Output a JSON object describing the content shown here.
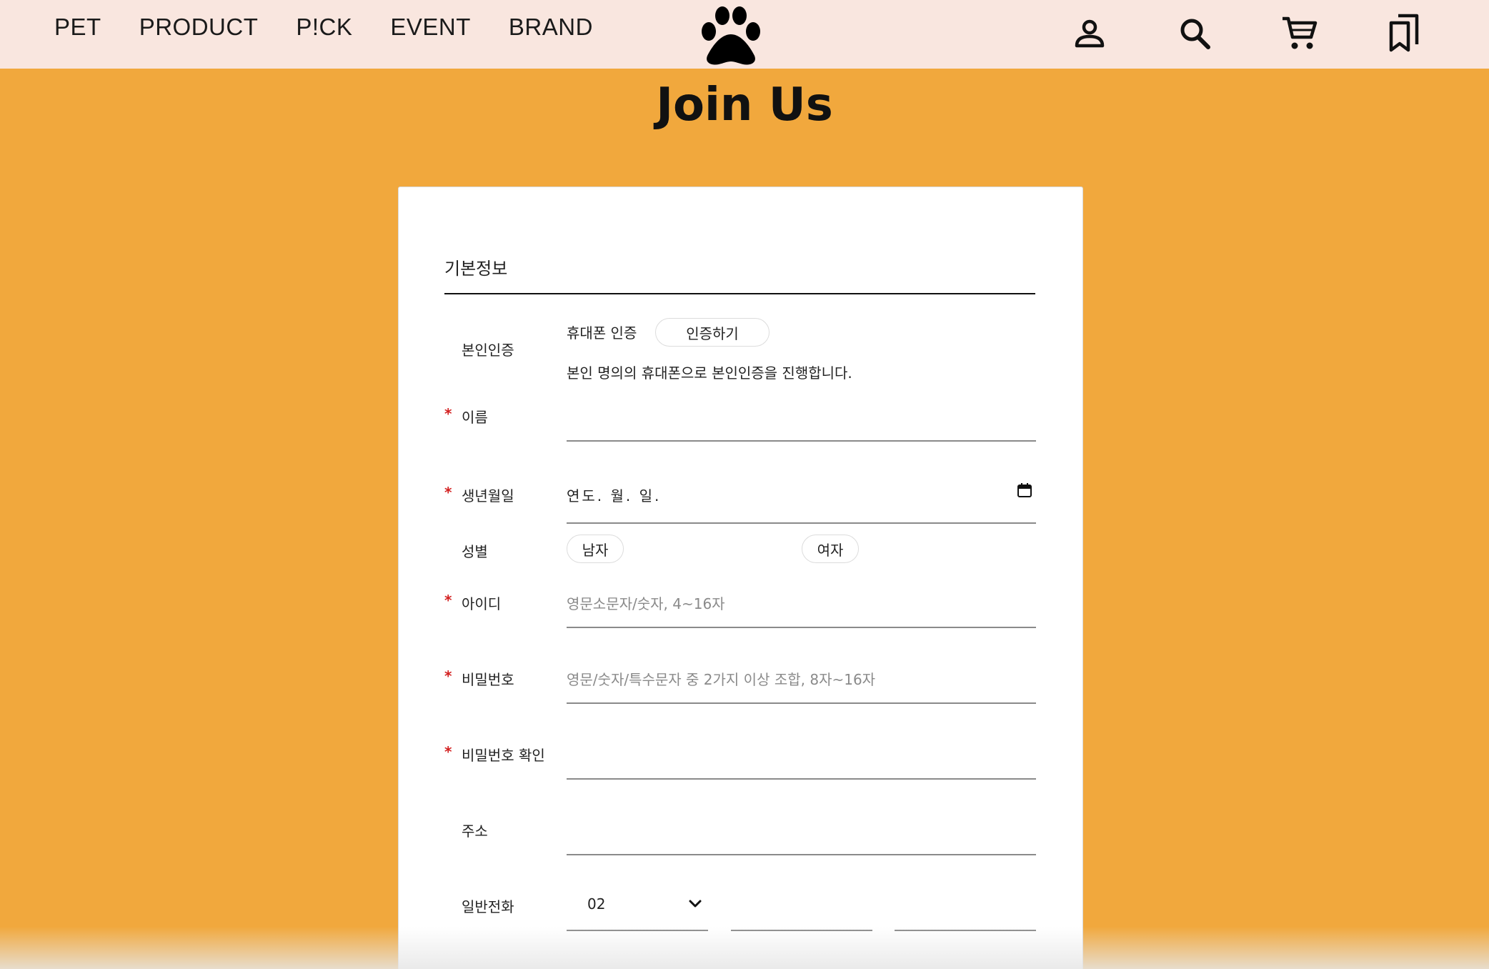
{
  "nav": {
    "items": [
      "PET",
      "PRODUCT",
      "P!CK",
      "EVENT",
      "BRAND"
    ]
  },
  "header_icons": [
    "user-icon",
    "search-icon",
    "cart-icon",
    "bookmark-icon"
  ],
  "page_title": "Join Us",
  "colors": {
    "background": "#F1A83D",
    "header": "#F9E6DF",
    "required": "#D32020"
  },
  "form": {
    "section_title": "기본정보",
    "verification": {
      "label": "본인인증",
      "method": "휴대폰 인증",
      "button": "인증하기",
      "note": "본인 명의의 휴대폰으로 본인인증을 진행합니다."
    },
    "name": {
      "label": "이름",
      "required_mark": "*",
      "value": ""
    },
    "birthdate": {
      "label": "생년월일",
      "required_mark": "*",
      "value": "연도. 월. 일."
    },
    "gender": {
      "label": "성별",
      "options": [
        "남자",
        "여자"
      ]
    },
    "user_id": {
      "label": "아이디",
      "required_mark": "*",
      "placeholder": "영문소문자/숫자, 4~16자"
    },
    "password": {
      "label": "비밀번호",
      "required_mark": "*",
      "placeholder": "영문/숫자/특수문자 중 2가지 이상 조합, 8자~16자"
    },
    "password_confirm": {
      "label": "비밀번호 확인",
      "required_mark": "*"
    },
    "address": {
      "label": "주소"
    },
    "phone": {
      "label": "일반전화",
      "area_code": "02"
    }
  }
}
